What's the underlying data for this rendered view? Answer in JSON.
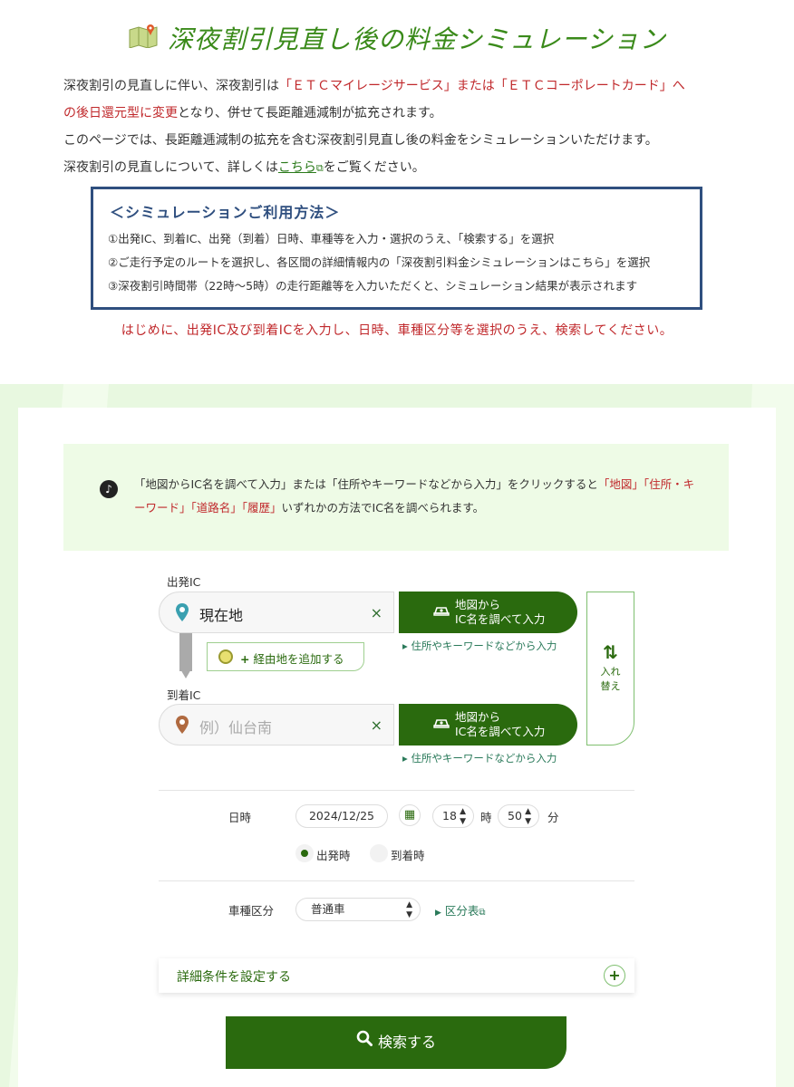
{
  "title": "深夜割引見直し後の料金シミュレーション",
  "intro": {
    "l1_a": "深夜割引の見直しに伴い、深夜割引は",
    "l1_b": "「ＥＴＣマイレージサービス」または「ＥＴＣコーポレートカード」へ",
    "l2_a": "の後日還元型に変更",
    "l2_b": "となり、併せて長距離逓減制が拡充されます。",
    "l3": "このページでは、長距離逓減制の拡充を含む深夜割引見直し後の料金をシミュレーションいただけます。",
    "l4_a": "深夜割引の見直しについて、詳しくは",
    "l4_link": "こちら",
    "l4_b": "をご覧ください。"
  },
  "howto": {
    "heading": "＜シミュレーションご利用方法＞",
    "step1": "①出発IC、到着IC、出発（到着）日時、車種等を入力・選択のうえ、「検索する」を選択",
    "step2": "②ご走行予定のルートを選択し、各区間の詳細情報内の「深夜割引料金シミュレーションはこちら」を選択",
    "step3": "③深夜割引時間帯（22時～5時）の走行距離等を入力いただくと、シミュレーション結果が表示されます"
  },
  "notice": "はじめに、出発IC及び到着ICを入力し、日時、車種区分等を選択のうえ、検索してください。",
  "tip": {
    "a": "「地図からIC名を調べて入力」または「住所やキーワードなどから入力」をクリックすると",
    "b": "「地図」「住所・キーワード」「道路名」「履歴」",
    "c": "いずれかの方法でIC名を調べられます。"
  },
  "departure": {
    "label": "出発IC",
    "value": "現在地",
    "clear": "×",
    "map_btn_1": "地図から",
    "map_btn_2": "IC名を調べて入力",
    "addr_link": "住所やキーワードなどから入力"
  },
  "via_button": "経由地を追加する",
  "arrival": {
    "label": "到着IC",
    "placeholder": "例）仙台南",
    "clear": "×",
    "map_btn_1": "地図から",
    "map_btn_2": "IC名を調べて入力",
    "addr_link": "住所やキーワードなどから入力"
  },
  "swap": {
    "l1": "入れ",
    "l2": "替え"
  },
  "datetime": {
    "label": "日時",
    "date": "2024/12/25",
    "hour": "18",
    "hour_unit": "時",
    "minute": "50",
    "minute_unit": "分",
    "radio_depart": "出発時",
    "radio_arrive": "到着時",
    "selected": "出発時"
  },
  "vehicle": {
    "label": "車種区分",
    "value": "普通車",
    "table_link": "区分表"
  },
  "detail": {
    "label": "詳細条件を設定する",
    "plus": "+"
  },
  "search": {
    "label": "検索する"
  },
  "colors": {
    "brand_green": "#2a6a0e",
    "title_green": "#3a8a1a",
    "red": "#c0282b",
    "navy": "#2f4f7f"
  }
}
